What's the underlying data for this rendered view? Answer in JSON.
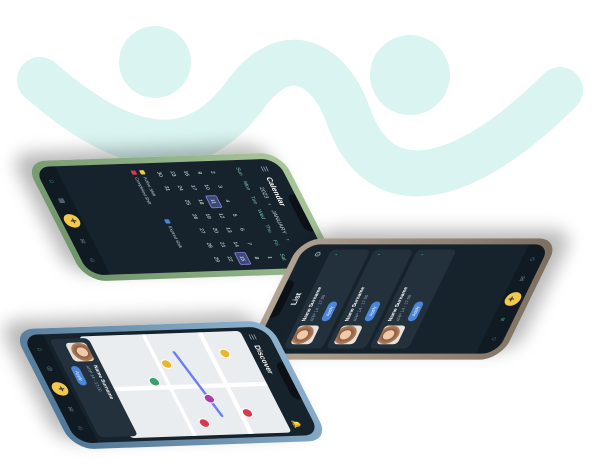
{
  "brand": {
    "wave_color": "#d6f3ef",
    "accent_green": "#3ec28e",
    "fab_yellow": "#f2c94c",
    "button_blue": "#4b86d8"
  },
  "calendar_phone": {
    "title": "Calendar",
    "year": "2023",
    "month": "JANUARY",
    "weekdays": [
      "Sun",
      "Mon",
      "Tue",
      "Wed",
      "Thu",
      "Fri",
      "Sat"
    ],
    "days": [
      "",
      "",
      "",
      "",
      "",
      "",
      "1",
      "2",
      "3",
      "4",
      "5",
      "6",
      "7",
      "8",
      "9",
      "10",
      "11",
      "12",
      "13",
      "14",
      "15",
      "16",
      "17",
      "18",
      "19",
      "20",
      "21",
      "22",
      "23",
      "24",
      "25",
      "26",
      "27",
      "28",
      "29",
      "30",
      "31"
    ],
    "selected_days": [
      "11",
      "15"
    ],
    "legend": [
      {
        "label": "Active Shift",
        "color": "#f2c94c"
      },
      {
        "label": "Expired Shift",
        "color": "#4b86d8"
      },
      {
        "label": "Completed Shift",
        "color": "#d9394a"
      }
    ],
    "tabs": [
      "home-icon",
      "calendar-icon",
      "add-icon",
      "chat-icon",
      "profile-icon"
    ]
  },
  "list_phone": {
    "title": "List",
    "cards": [
      {
        "name": "Name Surname",
        "meta": "ARP 14 - 17:00",
        "button": "Apply"
      },
      {
        "name": "Name Surname",
        "meta": "ARP 14 - 17:00",
        "button": "Apply"
      },
      {
        "name": "Name Surname",
        "meta": "ARP 14 - 17:00",
        "button": "Apply"
      }
    ]
  },
  "map_phone": {
    "title": "Discover",
    "card": {
      "name": "Name Surname",
      "meta": "ARP 14 - 17:00",
      "button": "Apply"
    }
  }
}
